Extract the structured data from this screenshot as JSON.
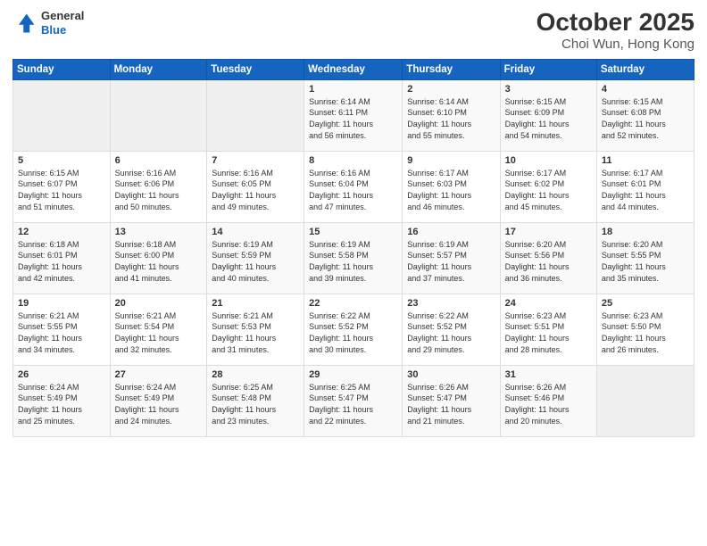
{
  "header": {
    "logo_line1": "General",
    "logo_line2": "Blue",
    "title": "October 2025",
    "subtitle": "Choi Wun, Hong Kong"
  },
  "days_of_week": [
    "Sunday",
    "Monday",
    "Tuesday",
    "Wednesday",
    "Thursday",
    "Friday",
    "Saturday"
  ],
  "weeks": [
    [
      {
        "day": "",
        "info": ""
      },
      {
        "day": "",
        "info": ""
      },
      {
        "day": "",
        "info": ""
      },
      {
        "day": "1",
        "info": "Sunrise: 6:14 AM\nSunset: 6:11 PM\nDaylight: 11 hours\nand 56 minutes."
      },
      {
        "day": "2",
        "info": "Sunrise: 6:14 AM\nSunset: 6:10 PM\nDaylight: 11 hours\nand 55 minutes."
      },
      {
        "day": "3",
        "info": "Sunrise: 6:15 AM\nSunset: 6:09 PM\nDaylight: 11 hours\nand 54 minutes."
      },
      {
        "day": "4",
        "info": "Sunrise: 6:15 AM\nSunset: 6:08 PM\nDaylight: 11 hours\nand 52 minutes."
      }
    ],
    [
      {
        "day": "5",
        "info": "Sunrise: 6:15 AM\nSunset: 6:07 PM\nDaylight: 11 hours\nand 51 minutes."
      },
      {
        "day": "6",
        "info": "Sunrise: 6:16 AM\nSunset: 6:06 PM\nDaylight: 11 hours\nand 50 minutes."
      },
      {
        "day": "7",
        "info": "Sunrise: 6:16 AM\nSunset: 6:05 PM\nDaylight: 11 hours\nand 49 minutes."
      },
      {
        "day": "8",
        "info": "Sunrise: 6:16 AM\nSunset: 6:04 PM\nDaylight: 11 hours\nand 47 minutes."
      },
      {
        "day": "9",
        "info": "Sunrise: 6:17 AM\nSunset: 6:03 PM\nDaylight: 11 hours\nand 46 minutes."
      },
      {
        "day": "10",
        "info": "Sunrise: 6:17 AM\nSunset: 6:02 PM\nDaylight: 11 hours\nand 45 minutes."
      },
      {
        "day": "11",
        "info": "Sunrise: 6:17 AM\nSunset: 6:01 PM\nDaylight: 11 hours\nand 44 minutes."
      }
    ],
    [
      {
        "day": "12",
        "info": "Sunrise: 6:18 AM\nSunset: 6:01 PM\nDaylight: 11 hours\nand 42 minutes."
      },
      {
        "day": "13",
        "info": "Sunrise: 6:18 AM\nSunset: 6:00 PM\nDaylight: 11 hours\nand 41 minutes."
      },
      {
        "day": "14",
        "info": "Sunrise: 6:19 AM\nSunset: 5:59 PM\nDaylight: 11 hours\nand 40 minutes."
      },
      {
        "day": "15",
        "info": "Sunrise: 6:19 AM\nSunset: 5:58 PM\nDaylight: 11 hours\nand 39 minutes."
      },
      {
        "day": "16",
        "info": "Sunrise: 6:19 AM\nSunset: 5:57 PM\nDaylight: 11 hours\nand 37 minutes."
      },
      {
        "day": "17",
        "info": "Sunrise: 6:20 AM\nSunset: 5:56 PM\nDaylight: 11 hours\nand 36 minutes."
      },
      {
        "day": "18",
        "info": "Sunrise: 6:20 AM\nSunset: 5:55 PM\nDaylight: 11 hours\nand 35 minutes."
      }
    ],
    [
      {
        "day": "19",
        "info": "Sunrise: 6:21 AM\nSunset: 5:55 PM\nDaylight: 11 hours\nand 34 minutes."
      },
      {
        "day": "20",
        "info": "Sunrise: 6:21 AM\nSunset: 5:54 PM\nDaylight: 11 hours\nand 32 minutes."
      },
      {
        "day": "21",
        "info": "Sunrise: 6:21 AM\nSunset: 5:53 PM\nDaylight: 11 hours\nand 31 minutes."
      },
      {
        "day": "22",
        "info": "Sunrise: 6:22 AM\nSunset: 5:52 PM\nDaylight: 11 hours\nand 30 minutes."
      },
      {
        "day": "23",
        "info": "Sunrise: 6:22 AM\nSunset: 5:52 PM\nDaylight: 11 hours\nand 29 minutes."
      },
      {
        "day": "24",
        "info": "Sunrise: 6:23 AM\nSunset: 5:51 PM\nDaylight: 11 hours\nand 28 minutes."
      },
      {
        "day": "25",
        "info": "Sunrise: 6:23 AM\nSunset: 5:50 PM\nDaylight: 11 hours\nand 26 minutes."
      }
    ],
    [
      {
        "day": "26",
        "info": "Sunrise: 6:24 AM\nSunset: 5:49 PM\nDaylight: 11 hours\nand 25 minutes."
      },
      {
        "day": "27",
        "info": "Sunrise: 6:24 AM\nSunset: 5:49 PM\nDaylight: 11 hours\nand 24 minutes."
      },
      {
        "day": "28",
        "info": "Sunrise: 6:25 AM\nSunset: 5:48 PM\nDaylight: 11 hours\nand 23 minutes."
      },
      {
        "day": "29",
        "info": "Sunrise: 6:25 AM\nSunset: 5:47 PM\nDaylight: 11 hours\nand 22 minutes."
      },
      {
        "day": "30",
        "info": "Sunrise: 6:26 AM\nSunset: 5:47 PM\nDaylight: 11 hours\nand 21 minutes."
      },
      {
        "day": "31",
        "info": "Sunrise: 6:26 AM\nSunset: 5:46 PM\nDaylight: 11 hours\nand 20 minutes."
      },
      {
        "day": "",
        "info": ""
      }
    ]
  ]
}
